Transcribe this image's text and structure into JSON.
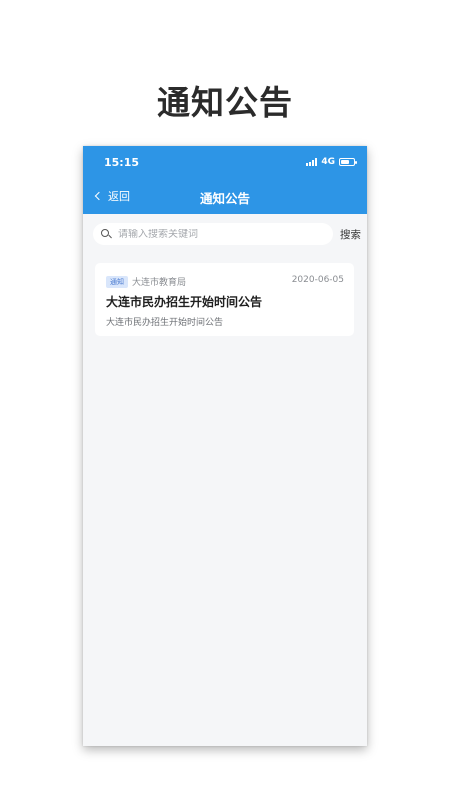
{
  "promo": {
    "title": "通知公告"
  },
  "status_bar": {
    "time": "15:15",
    "network": "4G",
    "battery_level": 0.7
  },
  "header": {
    "back_label": "返回",
    "title": "通知公告"
  },
  "search": {
    "placeholder": "请输入搜索关键词",
    "value": "",
    "button_label": "搜索"
  },
  "notices": [
    {
      "tag": "通知",
      "source": "大连市教育局",
      "date": "2020-06-05",
      "title": "大连市民办招生开始时间公告",
      "summary": "大连市民办招生开始时间公告"
    }
  ],
  "colors": {
    "primary": "#2d95e6",
    "background": "#f5f6f8",
    "badge_bg": "#d9e6fb",
    "badge_text": "#4a7ad0"
  },
  "icons": {
    "back": "chevron-left-icon",
    "search": "search-icon",
    "signal": "signal-icon",
    "battery": "battery-icon"
  }
}
